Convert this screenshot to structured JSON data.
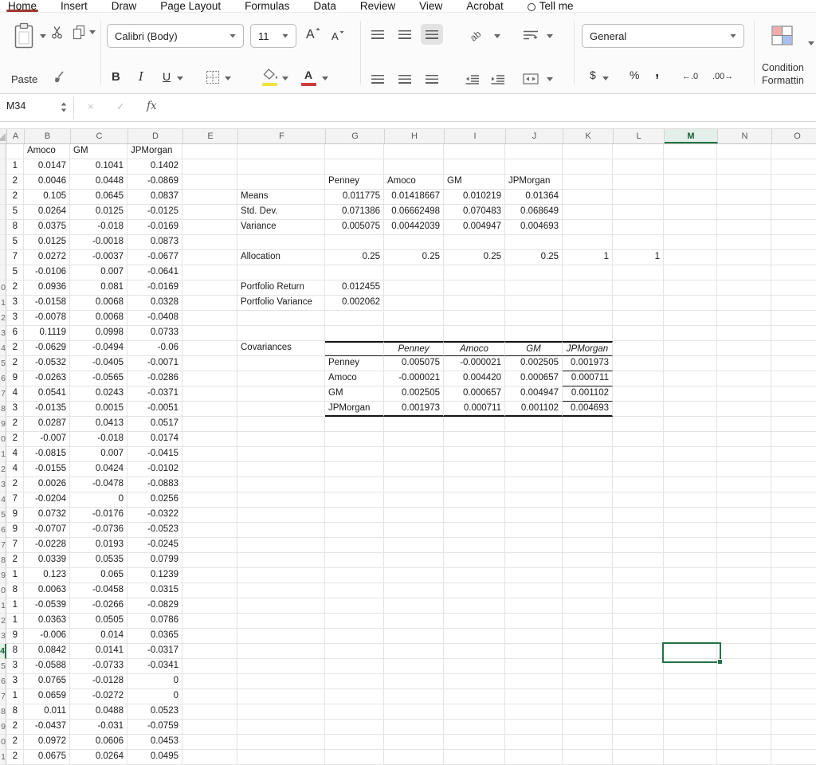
{
  "colors": {
    "accent_green": "#217346",
    "tab_underline": "#9e372c",
    "fill_yellow": "#efe33c",
    "font_color_red": "#cc3b3b"
  },
  "menu": {
    "items": [
      "Home",
      "Insert",
      "Draw",
      "Page Layout",
      "Formulas",
      "Data",
      "Review",
      "View",
      "Acrobat",
      "Tell me"
    ],
    "active": "Home"
  },
  "ribbon": {
    "paste_label": "Paste",
    "font_name": "Calibri (Body)",
    "font_size": "11",
    "grow_font": "A",
    "shrink_font": "A",
    "bold": "B",
    "italic": "I",
    "underline": "U",
    "orientation_glyph": "ab",
    "number_format": "General",
    "currency": "$",
    "percent": "%",
    "comma": ",",
    "dec_increase": "←.0",
    "dec_decrease": ".00→",
    "font_color_letter": "A",
    "conditional_line1": "Condition",
    "conditional_line2": "Formattin"
  },
  "formula_bar": {
    "name_box": "M34",
    "cancel": "×",
    "enter": "✓",
    "fx": "fx"
  },
  "sheet": {
    "a_header": "A",
    "col_headers": [
      "B",
      "C",
      "D",
      "E",
      "F",
      "G",
      "H",
      "I",
      "J",
      "K",
      "L",
      "M",
      "N",
      "O"
    ],
    "active_col": "M",
    "active_cell": "M34",
    "rows": [
      {
        "num": "",
        "a": "",
        "cells": {
          "B": {
            "t": "Amoco",
            "tx": 1
          },
          "C": {
            "t": "GM",
            "tx": 1
          },
          "D": {
            "t": "JPMorgan",
            "tx": 1
          }
        }
      },
      {
        "num": "",
        "a": "1",
        "cells": {
          "B": "0.0147",
          "C": "0.1041",
          "D": "0.1402"
        }
      },
      {
        "num": "",
        "a": "2",
        "cells": {
          "B": "0.0046",
          "C": "0.0448",
          "D": "-0.0869",
          "G": {
            "t": "Penney",
            "tx": 1
          },
          "H": {
            "t": "Amoco",
            "tx": 1
          },
          "I": {
            "t": "GM",
            "tx": 1
          },
          "J": {
            "t": "JPMorgan",
            "tx": 1
          }
        }
      },
      {
        "num": "",
        "a": "2",
        "cells": {
          "B": "0.105",
          "C": "0.0645",
          "D": "0.0837",
          "F": {
            "t": "Means",
            "tx": 1
          },
          "G": "0.011775",
          "H": "0.01418667",
          "I": "0.010219",
          "J": "0.01364"
        }
      },
      {
        "num": "",
        "a": "5",
        "cells": {
          "B": "0.0264",
          "C": "0.0125",
          "D": "-0.0125",
          "F": {
            "t": "Std. Dev.",
            "tx": 1
          },
          "G": "0.071386",
          "H": "0.06662498",
          "I": "0.070483",
          "J": "0.068649"
        }
      },
      {
        "num": "",
        "a": "8",
        "cells": {
          "B": "0.0375",
          "C": "-0.018",
          "D": "-0.0169",
          "F": {
            "t": "Variance",
            "tx": 1
          },
          "G": "0.005075",
          "H": "0.00442039",
          "I": "0.004947",
          "J": "0.004693"
        }
      },
      {
        "num": "",
        "a": "5",
        "cells": {
          "B": "0.0125",
          "C": "-0.0018",
          "D": "0.0873"
        }
      },
      {
        "num": "",
        "a": "7",
        "cells": {
          "B": "0.0272",
          "C": "-0.0037",
          "D": "-0.0677",
          "F": {
            "t": "Allocation",
            "tx": 1
          },
          "G": "0.25",
          "H": "0.25",
          "I": "0.25",
          "J": "0.25",
          "K": "1",
          "L": "1"
        }
      },
      {
        "num": "",
        "a": "5",
        "cells": {
          "B": "-0.0106",
          "C": "0.007",
          "D": "-0.0641"
        }
      },
      {
        "num": "0",
        "a": "2",
        "cells": {
          "B": "0.0936",
          "C": "0.081",
          "D": "-0.0169",
          "F": {
            "t": "Portfolio Return",
            "tx": 1
          },
          "G": "0.012455"
        }
      },
      {
        "num": "1",
        "a": "3",
        "cells": {
          "B": "-0.0158",
          "C": "0.0068",
          "D": "0.0328",
          "F": {
            "t": "Portfolio Variance",
            "tx": 1
          },
          "G": "0.002062"
        }
      },
      {
        "num": "2",
        "a": "3",
        "cells": {
          "B": "-0.0078",
          "C": "0.0068",
          "D": "-0.0408"
        }
      },
      {
        "num": "3",
        "a": "6",
        "cells": {
          "B": "0.1119",
          "C": "0.0998",
          "D": "0.0733"
        }
      },
      {
        "num": "4",
        "a": "2",
        "cells": {
          "B": "-0.0629",
          "C": "-0.0494",
          "D": "-0.06",
          "F": {
            "t": "Covariances",
            "tx": 1
          },
          "G": {
            "t": "",
            "bt": 1,
            "bb": 1
          },
          "H": {
            "t": "Penney",
            "i": 1,
            "ct": 1,
            "bt": 1,
            "bb": 1
          },
          "I": {
            "t": "Amoco",
            "i": 1,
            "ct": 1,
            "bt": 1,
            "bb": 1
          },
          "J": {
            "t": "GM",
            "i": 1,
            "ct": 1,
            "bt": 1,
            "bb": 1
          },
          "K": {
            "t": "JPMorgan",
            "i": 1,
            "ct": 1,
            "bt": 1,
            "bb": 1
          }
        }
      },
      {
        "num": "5",
        "a": "2",
        "cells": {
          "B": "-0.0532",
          "C": "-0.0405",
          "D": "-0.0071",
          "G": {
            "t": "Penney",
            "tx": 1
          },
          "H": "0.005075",
          "I": "-0.000021",
          "J": "0.002505",
          "K": {
            "t": "0.001973",
            "bb": 1
          }
        }
      },
      {
        "num": "6",
        "a": "9",
        "cells": {
          "B": "-0.0263",
          "C": "-0.0565",
          "D": "-0.0286",
          "G": {
            "t": "Amoco",
            "tx": 1
          },
          "H": "-0.000021",
          "I": "0.004420",
          "J": "0.000657",
          "K": {
            "t": "0.000711",
            "bb": 1
          }
        }
      },
      {
        "num": "7",
        "a": "4",
        "cells": {
          "B": "0.0541",
          "C": "0.0243",
          "D": "-0.0371",
          "G": {
            "t": "GM",
            "tx": 1
          },
          "H": "0.002505",
          "I": "0.000657",
          "J": "0.004947",
          "K": {
            "t": "0.001102",
            "bb": 1
          }
        }
      },
      {
        "num": "8",
        "a": "3",
        "cells": {
          "B": "-0.0135",
          "C": "0.0015",
          "D": "-0.0051",
          "G": {
            "t": "JPMorgan",
            "tx": 1,
            "bb2": 1
          },
          "H": {
            "t": "0.001973",
            "bb2": 1
          },
          "I": {
            "t": "0.000711",
            "bb2": 1
          },
          "J": {
            "t": "0.001102",
            "bb2": 1
          },
          "K": {
            "t": "0.004693",
            "bb2": 1
          }
        }
      },
      {
        "num": "9",
        "a": "2",
        "cells": {
          "B": "0.0287",
          "C": "0.0413",
          "D": "0.0517"
        }
      },
      {
        "num": "0",
        "a": "2",
        "cells": {
          "B": "-0.007",
          "C": "-0.018",
          "D": "0.0174"
        }
      },
      {
        "num": "1",
        "a": "4",
        "cells": {
          "B": "-0.0815",
          "C": "0.007",
          "D": "-0.0415"
        }
      },
      {
        "num": "2",
        "a": "4",
        "cells": {
          "B": "-0.0155",
          "C": "0.0424",
          "D": "-0.0102"
        }
      },
      {
        "num": "3",
        "a": "2",
        "cells": {
          "B": "0.0026",
          "C": "-0.0478",
          "D": "-0.0883"
        }
      },
      {
        "num": "4",
        "a": "7",
        "cells": {
          "B": "-0.0204",
          "C": "0",
          "D": "0.0256"
        }
      },
      {
        "num": "5",
        "a": "9",
        "cells": {
          "B": "0.0732",
          "C": "-0.0176",
          "D": "-0.0322"
        }
      },
      {
        "num": "6",
        "a": "9",
        "cells": {
          "B": "-0.0707",
          "C": "-0.0736",
          "D": "-0.0523"
        }
      },
      {
        "num": "7",
        "a": "7",
        "cells": {
          "B": "-0.0228",
          "C": "0.0193",
          "D": "-0.0245"
        }
      },
      {
        "num": "8",
        "a": "2",
        "cells": {
          "B": "0.0339",
          "C": "0.0535",
          "D": "0.0799"
        }
      },
      {
        "num": "9",
        "a": "1",
        "cells": {
          "B": "0.123",
          "C": "0.065",
          "D": "0.1239"
        }
      },
      {
        "num": "0",
        "a": "8",
        "cells": {
          "B": "0.0063",
          "C": "-0.0458",
          "D": "0.0315"
        }
      },
      {
        "num": "1",
        "a": "1",
        "cells": {
          "B": "-0.0539",
          "C": "-0.0266",
          "D": "-0.0829"
        }
      },
      {
        "num": "2",
        "a": "1",
        "cells": {
          "B": "0.0363",
          "C": "0.0505",
          "D": "0.0786"
        }
      },
      {
        "num": "3",
        "a": "9",
        "cells": {
          "B": "-0.006",
          "C": "0.014",
          "D": "0.0365"
        }
      },
      {
        "num": "4",
        "a": "8",
        "active": true,
        "cells": {
          "B": "0.0842",
          "C": "0.0141",
          "D": "-0.0317"
        }
      },
      {
        "num": "5",
        "a": "3",
        "cells": {
          "B": "-0.0588",
          "C": "-0.0733",
          "D": "-0.0341"
        }
      },
      {
        "num": "6",
        "a": "3",
        "cells": {
          "B": "0.0765",
          "C": "-0.0128",
          "D": "0"
        }
      },
      {
        "num": "7",
        "a": "1",
        "cells": {
          "B": "0.0659",
          "C": "-0.0272",
          "D": "0"
        }
      },
      {
        "num": "8",
        "a": "8",
        "cells": {
          "B": "0.011",
          "C": "0.0488",
          "D": "0.0523"
        }
      },
      {
        "num": "9",
        "a": "2",
        "cells": {
          "B": "-0.0437",
          "C": "-0.031",
          "D": "-0.0759"
        }
      },
      {
        "num": "0",
        "a": "2",
        "cells": {
          "B": "0.0972",
          "C": "0.0606",
          "D": "0.0453"
        }
      },
      {
        "num": "1",
        "a": "2",
        "cells": {
          "B": "0.0675",
          "C": "0.0264",
          "D": "0.0495"
        }
      }
    ]
  }
}
